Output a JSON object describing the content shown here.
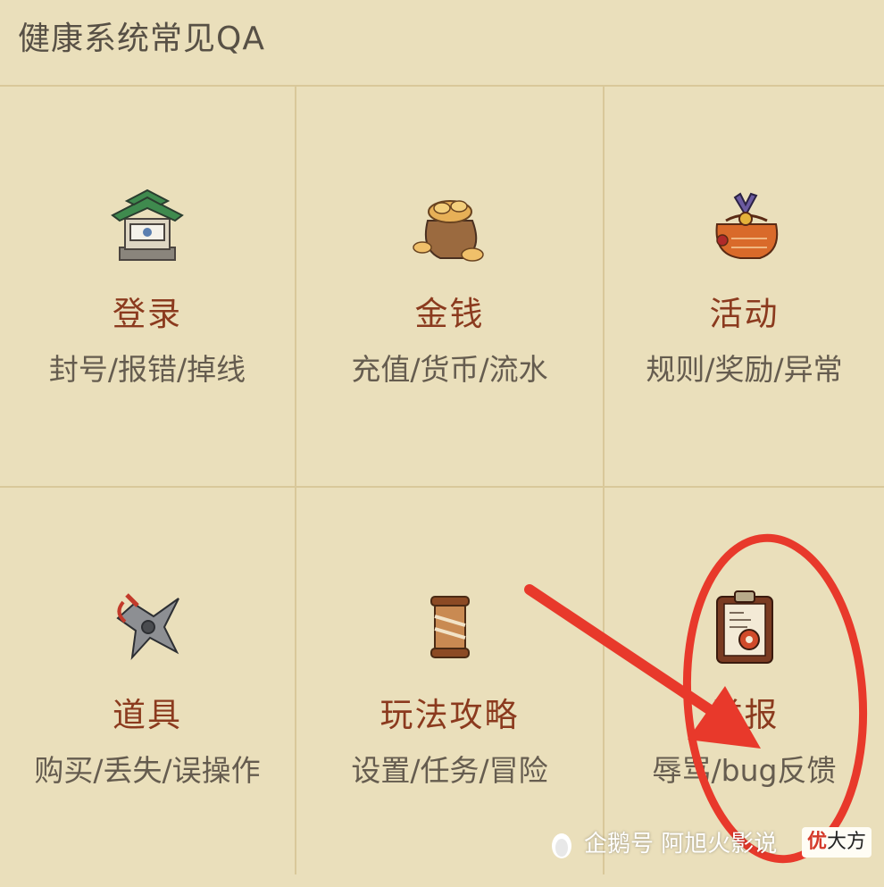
{
  "header": {
    "title": "健康系统常见QA"
  },
  "cells": [
    {
      "icon": "pagoda-gate-icon",
      "title": "登录",
      "subtitle": "封号/报错/掉线"
    },
    {
      "icon": "coin-bag-icon",
      "title": "金钱",
      "subtitle": "充值/货币/流水"
    },
    {
      "icon": "gift-pouch-icon",
      "title": "活动",
      "subtitle": "规则/奖励/异常"
    },
    {
      "icon": "shuriken-icon",
      "title": "道具",
      "subtitle": "购买/丢失/误操作"
    },
    {
      "icon": "scroll-icon",
      "title": "玩法攻略",
      "subtitle": "设置/任务/冒险"
    },
    {
      "icon": "clipboard-report-icon",
      "title": "举报",
      "subtitle": "辱骂/bug反馈"
    }
  ],
  "annotations": {
    "color": "#e8392b"
  },
  "watermark": {
    "text": "企鹅号 阿旭火影说",
    "badge_char": "优",
    "badge_text": "大方"
  },
  "colors": {
    "background": "#eadfbb",
    "title": "#8b3a1e",
    "subtitle": "#655c4f",
    "divider": "#d9c89a"
  }
}
